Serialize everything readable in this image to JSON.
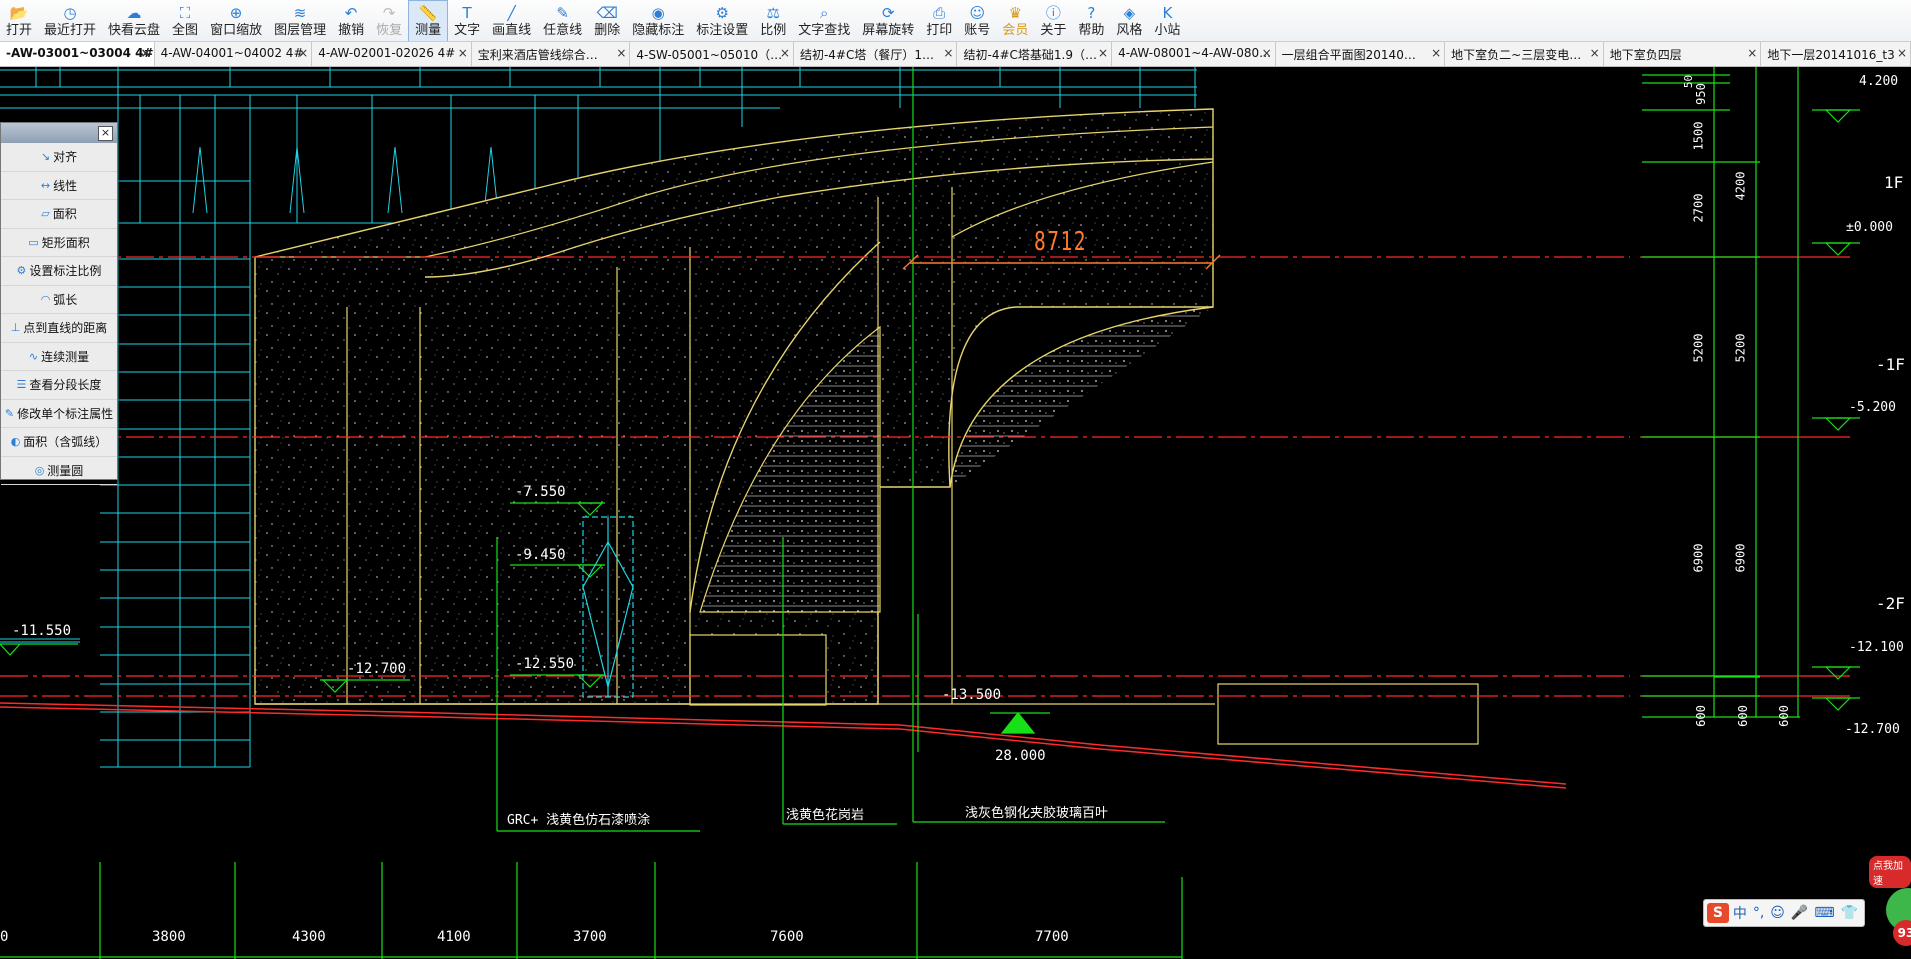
{
  "toolbar": {
    "items": [
      {
        "label": "打开",
        "icon": "folder-open-icon"
      },
      {
        "label": "最近打开",
        "icon": "clock-icon"
      },
      {
        "label": "快看云盘",
        "icon": "cloud-icon"
      },
      {
        "label": "全图",
        "icon": "fit-all-icon"
      },
      {
        "label": "窗口缩放",
        "icon": "zoom-window-icon"
      },
      {
        "label": "图层管理",
        "icon": "layers-icon"
      },
      {
        "label": "撤销",
        "icon": "undo-icon"
      },
      {
        "label": "恢复",
        "icon": "redo-icon"
      },
      {
        "label": "测量",
        "icon": "ruler-icon"
      },
      {
        "label": "文字",
        "icon": "text-icon"
      },
      {
        "label": "画直线",
        "icon": "line-icon"
      },
      {
        "label": "任意线",
        "icon": "pencil-icon"
      },
      {
        "label": "删除",
        "icon": "eraser-icon"
      },
      {
        "label": "隐藏标注",
        "icon": "eye-icon"
      },
      {
        "label": "标注设置",
        "icon": "gear-icon"
      },
      {
        "label": "比例",
        "icon": "scale-icon"
      },
      {
        "label": "文字查找",
        "icon": "find-text-icon"
      },
      {
        "label": "屏幕旋转",
        "icon": "rotate-icon"
      },
      {
        "label": "打印",
        "icon": "printer-icon"
      },
      {
        "label": "账号",
        "icon": "user-icon"
      },
      {
        "label": "会员",
        "icon": "vip-icon"
      },
      {
        "label": "关于",
        "icon": "info-icon"
      },
      {
        "label": "帮助",
        "icon": "help-icon"
      },
      {
        "label": "风格",
        "icon": "style-icon"
      },
      {
        "label": "小站",
        "icon": "k-station-icon"
      }
    ]
  },
  "tabs": [
    {
      "label": "-AW-03001~03004 4#"
    },
    {
      "label": "4-AW-04001~04002 4#"
    },
    {
      "label": "4-AW-02001-02026 4#"
    },
    {
      "label": "宝利来酒店管线综合…"
    },
    {
      "label": "4-SW-05001~05010（…"
    },
    {
      "label": "结初-4#C塔（餐厅）1…"
    },
    {
      "label": "结初-4#C塔基础1.9（…"
    },
    {
      "label": "4-AW-08001~4-AW-080…"
    },
    {
      "label": "一层组合平面图20140…"
    },
    {
      "label": "地下室负二~三层变电…"
    },
    {
      "label": "地下室负四层"
    },
    {
      "label": "地下一层20141016_t3"
    }
  ],
  "tab_close": "×",
  "measure_panel": {
    "close": "×",
    "items": [
      "对齐",
      "线性",
      "面积",
      "矩形面积",
      "设置标注比例",
      "弧长",
      "点到直线的距离",
      "连续测量",
      "查看分段长度",
      "修改单个标注属性",
      "面积（含弧线）",
      "测量圆"
    ]
  },
  "drawing": {
    "measurement": "8712",
    "levels_left": [
      "-7.550",
      "-9.450",
      "-12.550",
      "-12.700",
      "-11.550",
      "-13.500"
    ],
    "ground_elev": "28.000",
    "notes": [
      "GRC+  浅黄色仿石漆喷涂",
      "浅黄色花岗岩",
      "浅灰色钢化夹胶玻璃百叶"
    ],
    "right_dims_a": [
      "50",
      "950",
      "1500",
      "2700",
      "5200",
      "6900",
      "600"
    ],
    "right_dims_b": [
      "4200",
      "5200",
      "6900",
      "600"
    ],
    "right_dims_c": [
      "600"
    ],
    "right_levels": [
      "4.200",
      "±0.000",
      "-5.200",
      "-12.100",
      "-12.700"
    ],
    "floor_labels": [
      "1F",
      "-1F",
      "-2F"
    ],
    "bottom_dims": [
      "0",
      "3800",
      "4300",
      "4100",
      "3700",
      "7600",
      "7700"
    ]
  },
  "ime": {
    "logo": "S",
    "items": [
      "中",
      "°,",
      "☺",
      "🎤",
      "⌨",
      "👕"
    ]
  },
  "promo": {
    "badge": "点我加速",
    "count": "93"
  },
  "colors": {
    "cad_cyan": "#1fd5e6",
    "cad_red": "#ff2a2a",
    "cad_yellow": "#e6d46c",
    "cad_green": "#18e018",
    "cad_white": "#ffffff",
    "measure_orange": "#ff7a2a",
    "toolbar_accent": "#2c7fd6"
  }
}
